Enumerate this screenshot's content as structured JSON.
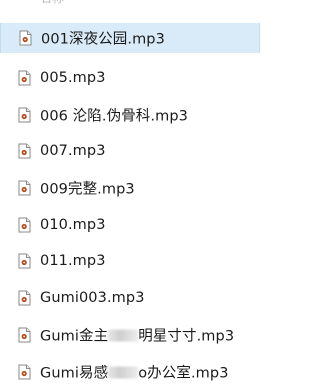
{
  "header": {
    "partial_text": "名称"
  },
  "files": [
    {
      "name": "001深夜公园.mp3",
      "selected": true
    },
    {
      "name": "005.mp3",
      "selected": false
    },
    {
      "name": "006 沦陷.伪骨科.mp3",
      "selected": false
    },
    {
      "name": "007.mp3",
      "selected": false
    },
    {
      "name": "009完整.mp3",
      "selected": false
    },
    {
      "name": "010.mp3",
      "selected": false
    },
    {
      "name": "011.mp3",
      "selected": false
    },
    {
      "name": "Gumi003.mp3",
      "selected": false
    },
    {
      "name_before": "Gumi金主",
      "name_after": "明星寸寸.mp3",
      "selected": false
    },
    {
      "name_before": "Gumi易感",
      "name_after": "o办公室.mp3",
      "selected": false
    }
  ],
  "icon": "audio-file-icon",
  "colors": {
    "selection_bg": "#d9ebf9",
    "selection_border": "#c2dcf2",
    "icon_accent": "#b84a1f",
    "text": "#1a1a1a"
  }
}
